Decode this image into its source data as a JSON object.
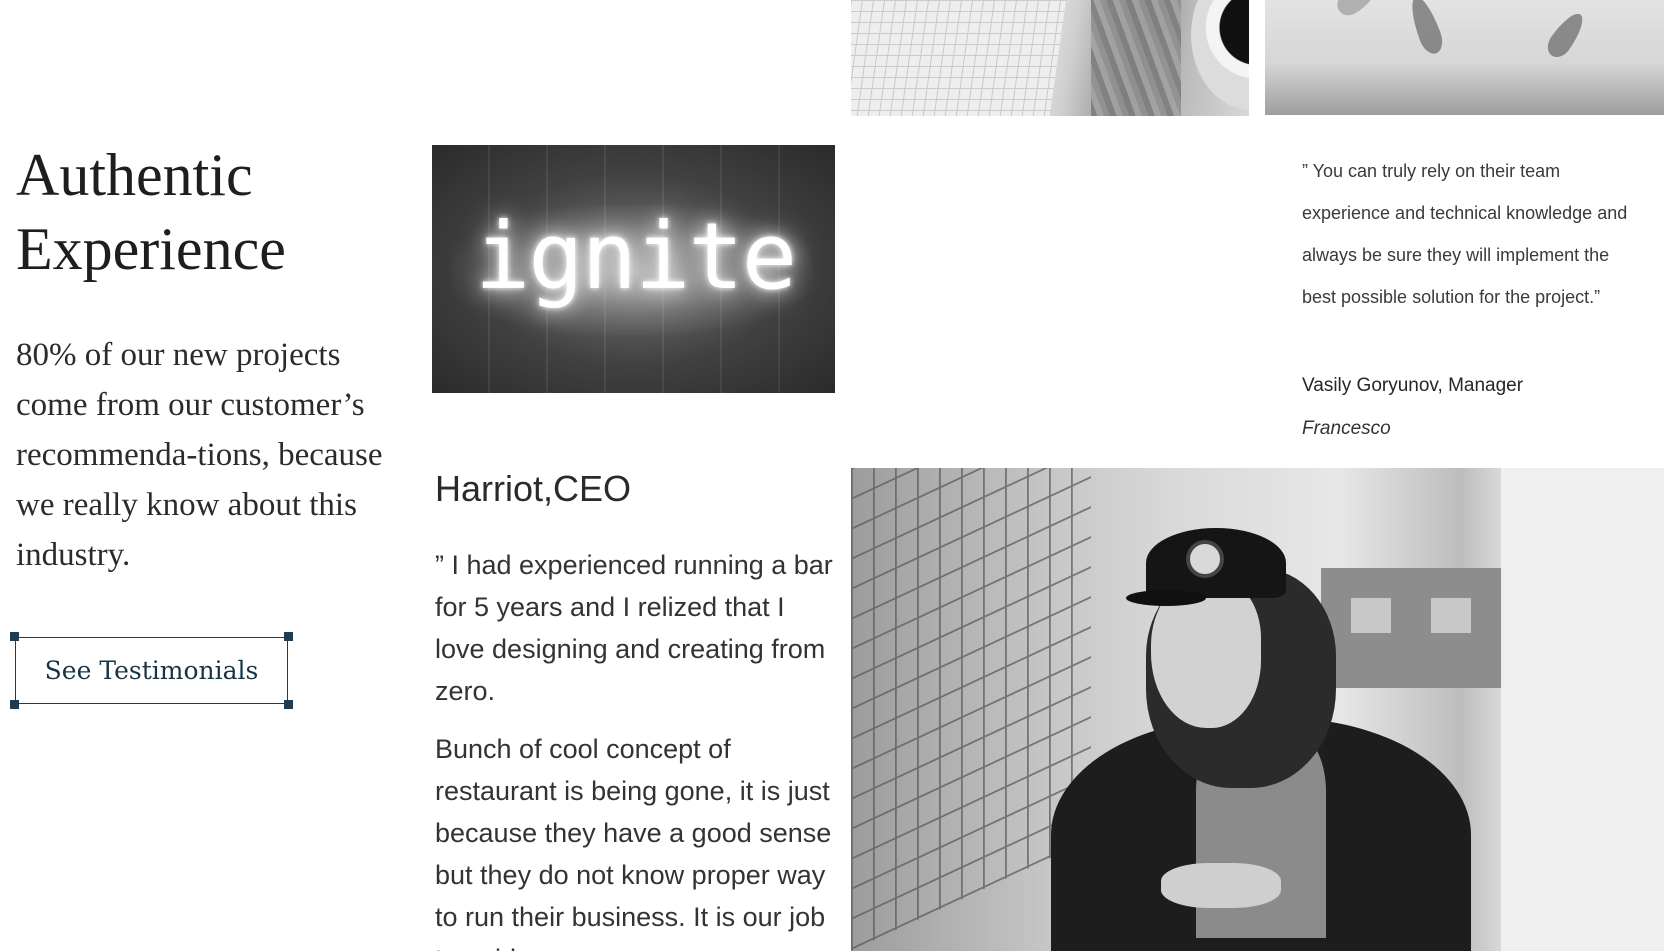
{
  "hero": {
    "heading": "Authentic Experience",
    "intro": "80% of our new projects come from our customer’s recommenda-tions, because we really know about this industry.",
    "cta_label": "See Testimonials"
  },
  "neon_sign": {
    "text": "ignite"
  },
  "story": {
    "name": "Harriot,CEO",
    "quote": "” I had experienced running a bar for 5 years and I relized that I love designing and creating from zero.",
    "body": "Bunch of cool concept of restaurant is being gone, it is just because they have a good sense but they do not know proper way to run their business. It is our job to guide"
  },
  "testimonial": {
    "quote": "” You can truly rely on their team experience and technical knowledge and always be sure they will implement the best possible solution for the project.”",
    "author": "Vasily Goryunov, Manager",
    "company": "Francesco"
  }
}
